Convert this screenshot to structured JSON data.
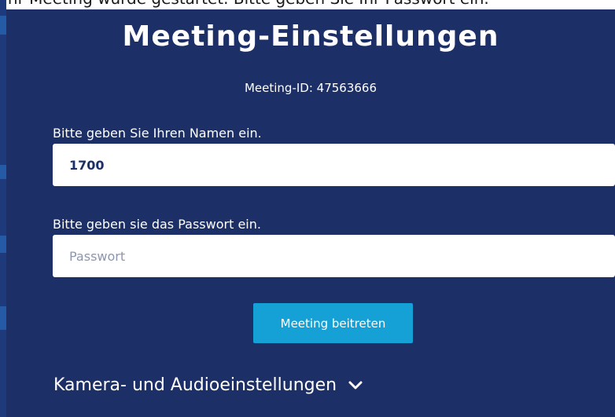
{
  "top_strip_text": "Ihr Meeting wurde gestartet. Bitte geben Sie Ihr Passwort ein.",
  "page": {
    "title": "Meeting-Einstellungen",
    "meeting_id": "Meeting-ID: 47563666"
  },
  "form": {
    "name_label": "Bitte geben Sie Ihren Namen ein.",
    "name_value": "1700",
    "password_label": "Bitte geben sie das Passwort ein.",
    "password_placeholder": "Passwort"
  },
  "actions": {
    "join_label": "Meeting beitreten",
    "settings_label": "Kamera- und Audioeinstellungen"
  },
  "icons": {
    "settings_toggle": "chevron-down-icon"
  },
  "colors": {
    "panel_bg": "#1c2f66",
    "accent": "#15a1d6",
    "text": "#ffffff"
  }
}
